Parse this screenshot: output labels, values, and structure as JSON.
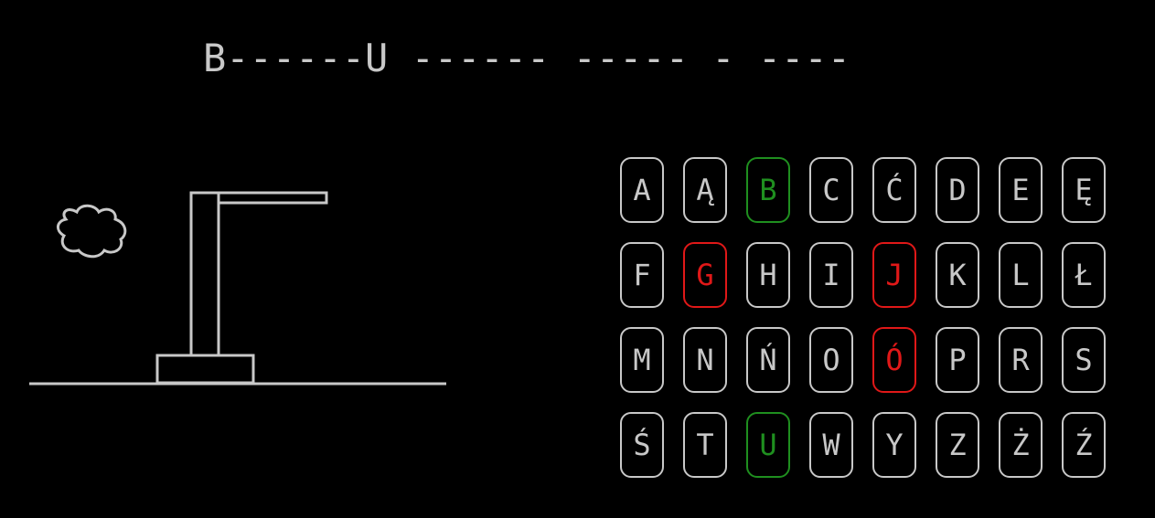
{
  "game": {
    "puzzle": "B------U ------ ----- - ----"
  },
  "keyboard": {
    "keys": [
      {
        "letter": "A",
        "state": "unused"
      },
      {
        "letter": "Ą",
        "state": "unused"
      },
      {
        "letter": "B",
        "state": "correct"
      },
      {
        "letter": "C",
        "state": "unused"
      },
      {
        "letter": "Ć",
        "state": "unused"
      },
      {
        "letter": "D",
        "state": "unused"
      },
      {
        "letter": "E",
        "state": "unused"
      },
      {
        "letter": "Ę",
        "state": "unused"
      },
      {
        "letter": "F",
        "state": "unused"
      },
      {
        "letter": "G",
        "state": "wrong"
      },
      {
        "letter": "H",
        "state": "unused"
      },
      {
        "letter": "I",
        "state": "unused"
      },
      {
        "letter": "J",
        "state": "wrong"
      },
      {
        "letter": "K",
        "state": "unused"
      },
      {
        "letter": "L",
        "state": "unused"
      },
      {
        "letter": "Ł",
        "state": "unused"
      },
      {
        "letter": "M",
        "state": "unused"
      },
      {
        "letter": "N",
        "state": "unused"
      },
      {
        "letter": "Ń",
        "state": "unused"
      },
      {
        "letter": "O",
        "state": "unused"
      },
      {
        "letter": "Ó",
        "state": "wrong"
      },
      {
        "letter": "P",
        "state": "unused"
      },
      {
        "letter": "R",
        "state": "unused"
      },
      {
        "letter": "S",
        "state": "unused"
      },
      {
        "letter": "Ś",
        "state": "unused"
      },
      {
        "letter": "T",
        "state": "unused"
      },
      {
        "letter": "U",
        "state": "correct"
      },
      {
        "letter": "W",
        "state": "unused"
      },
      {
        "letter": "Y",
        "state": "unused"
      },
      {
        "letter": "Z",
        "state": "unused"
      },
      {
        "letter": "Ż",
        "state": "unused"
      },
      {
        "letter": "Ź",
        "state": "unused"
      }
    ]
  },
  "colors": {
    "foreground": "#c8c8c8",
    "correct": "#1f8f1f",
    "wrong": "#e01818",
    "background": "#000000"
  }
}
